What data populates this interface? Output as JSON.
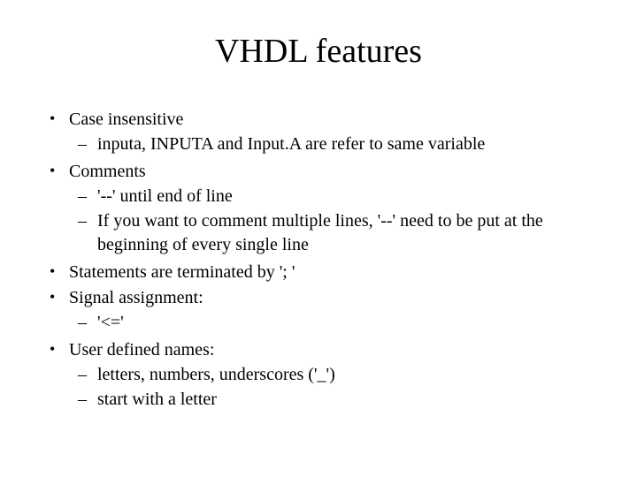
{
  "title": "VHDL features",
  "items": [
    {
      "text": "Case insensitive",
      "sub": [
        "inputa, INPUTA and Input.A are refer to same variable"
      ]
    },
    {
      "text": "Comments",
      "sub": [
        "'--' until end of line",
        "If you want to comment multiple lines, '--' need to be put at the beginning of every single line"
      ]
    },
    {
      "text": "Statements are terminated by '; '",
      "sub": []
    },
    {
      "text": "Signal assignment:",
      "sub": [
        "'<='"
      ]
    },
    {
      "text": "User defined names:",
      "sub": [
        "letters, numbers, underscores ('_')",
        "start with a letter"
      ]
    }
  ]
}
